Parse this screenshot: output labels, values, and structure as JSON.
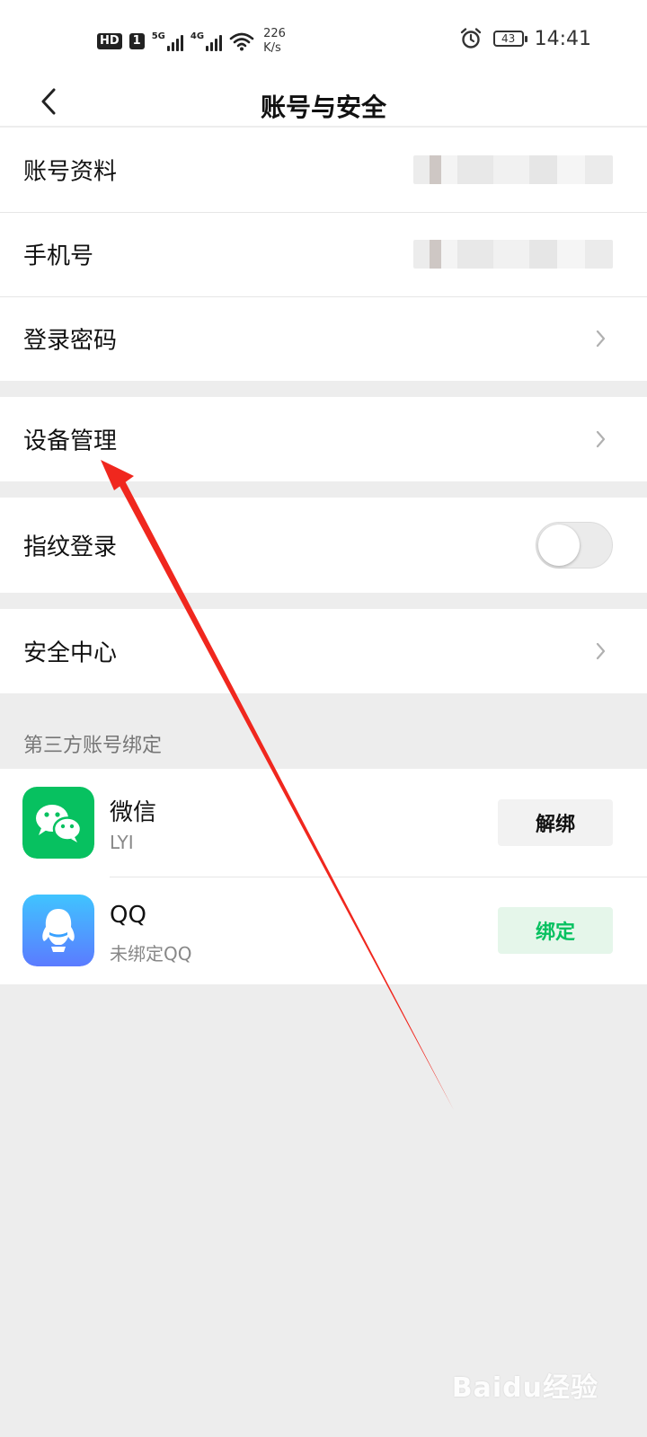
{
  "status_bar": {
    "hd_label": "HD",
    "sim_label": "1",
    "net1_label": "5G",
    "net2_label": "4G",
    "speed_value": "226",
    "speed_unit": "K/s",
    "battery_level": "43",
    "time": "14:41"
  },
  "nav": {
    "title": "账号与安全"
  },
  "account_rows": [
    {
      "label": "账号资料"
    },
    {
      "label": "手机号"
    },
    {
      "label": "登录密码"
    }
  ],
  "device_row": {
    "label": "设备管理"
  },
  "fingerprint_row": {
    "label": "指纹登录",
    "toggle_on": false
  },
  "security_row": {
    "label": "安全中心"
  },
  "third_party": {
    "section_title": "第三方账号绑定",
    "items": [
      {
        "name": "微信",
        "sub": "LYI",
        "button": "解绑",
        "icon": "wechat-icon",
        "color": "#07c160"
      },
      {
        "name": "QQ",
        "sub": "未绑定QQ",
        "button": "绑定",
        "icon": "qq-icon",
        "color": "#3aa2ff"
      }
    ]
  },
  "annotation": {
    "arrow_color": "#f0271e"
  },
  "watermark": {
    "text": "Baidu经验"
  }
}
